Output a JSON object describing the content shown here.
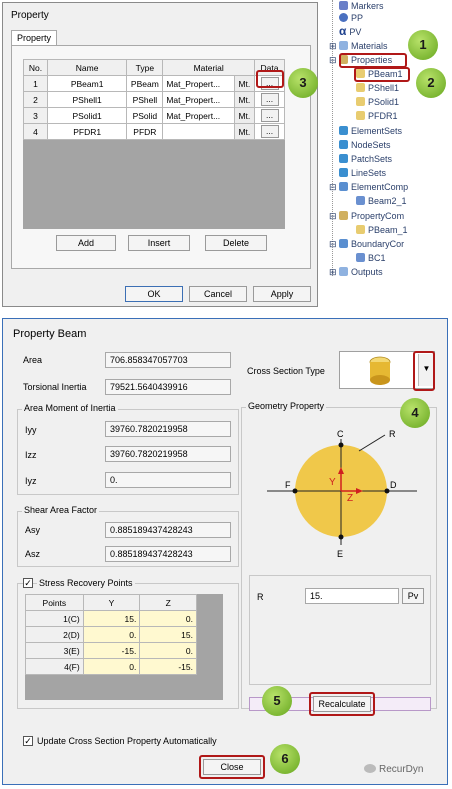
{
  "property_dialog": {
    "title": "Property",
    "tab": "Property",
    "headers": [
      "No.",
      "Name",
      "Type",
      "Material",
      "Data"
    ],
    "rows": [
      {
        "no": "1",
        "name": "PBeam1",
        "type": "PBeam",
        "material": "Mat_Propert...",
        "mt": "Mt.",
        "data": "..."
      },
      {
        "no": "2",
        "name": "PShell1",
        "type": "PShell",
        "material": "Mat_Propert...",
        "mt": "Mt.",
        "data": "..."
      },
      {
        "no": "3",
        "name": "PSolid1",
        "type": "PSolid",
        "material": "Mat_Propert...",
        "mt": "Mt.",
        "data": "..."
      },
      {
        "no": "4",
        "name": "PFDR1",
        "type": "PFDR",
        "material": "",
        "mt": "Mt.",
        "data": "..."
      }
    ],
    "add": "Add",
    "insert": "Insert",
    "delete": "Delete",
    "ok": "OK",
    "cancel": "Cancel",
    "apply": "Apply"
  },
  "tree": {
    "items": [
      "Markers",
      "PP",
      "PV",
      "Materials",
      "Properties",
      "PBeam1",
      "PShell1",
      "PSolid1",
      "PFDR1",
      "ElementSets",
      "NodeSets",
      "PatchSets",
      "LineSets",
      "ElementComp",
      "Beam2_1",
      "PropertyCom",
      "PBeam_1",
      "BoundaryCor",
      "BC1",
      "Outputs"
    ],
    "alpha": "α"
  },
  "beam_dialog": {
    "title": "Property Beam",
    "area_label": "Area",
    "area_value": "706.858347057703",
    "torsional_label": "Torsional Inertia",
    "torsional_value": "79521.5640439916",
    "moment_group": "Area Moment of Inertia",
    "iyy_label": "Iyy",
    "iyy_value": "39760.7820219958",
    "izz_label": "Izz",
    "izz_value": "39760.7820219958",
    "iyz_label": "Iyz",
    "iyz_value": "0.",
    "shear_group": "Shear Area Factor",
    "asy_label": "Asy",
    "asy_value": "0.885189437428243",
    "asz_label": "Asz",
    "asz_value": "0.885189437428243",
    "stress_label": "Stress Recovery Points",
    "stress_headers": [
      "Points",
      "Y",
      "Z"
    ],
    "stress_rows": [
      {
        "p": "1(C)",
        "y": "15.",
        "z": "0."
      },
      {
        "p": "2(D)",
        "y": "0.",
        "z": "15."
      },
      {
        "p": "3(E)",
        "y": "-15.",
        "z": "0."
      },
      {
        "p": "4(F)",
        "y": "0.",
        "z": "-15."
      }
    ],
    "cross_section_label": "Cross Section Type",
    "geometry_group": "Geometry Property",
    "geo_labels": {
      "c": "C",
      "r": "R",
      "f": "F",
      "d": "D",
      "y": "Y",
      "z": "Z",
      "e": "E"
    },
    "r_label": "R",
    "r_value": "15.",
    "pv": "Pv",
    "recalculate": "Recalculate",
    "update_label": "Update Cross Section Property Automatically",
    "close": "Close"
  },
  "callouts": [
    "1",
    "2",
    "3",
    "4",
    "5",
    "6"
  ],
  "watermark": "RecurDyn",
  "colors": {
    "highlight": "#b01818",
    "callout": "#7cbf2a",
    "beam_circle": "#f0c84a"
  }
}
